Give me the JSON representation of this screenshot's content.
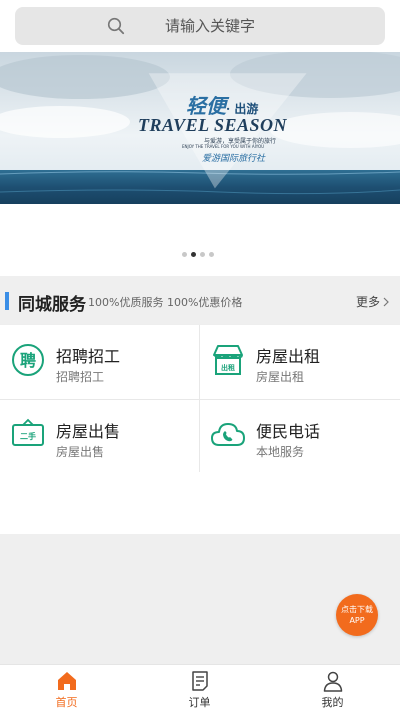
{
  "search": {
    "placeholder": "请输入关键字"
  },
  "banner": {
    "headline_cn": "轻便",
    "headline_suffix": "· 出游",
    "title": "TRAVEL SEASON",
    "subtitle_cn": "与爱游，享受属于你的旅行",
    "subtitle_en": "ENJOY THE TRAVEL FOR YOU WITH AIYOU",
    "brand": "爱游国际旅行社",
    "slide_count": 4,
    "active_slide": 2
  },
  "section": {
    "title": "同城服务",
    "desc": "100%优质服务 100%优惠价格",
    "more": "更多"
  },
  "services": [
    {
      "title": "招聘招工",
      "subtitle": "招聘招工",
      "icon": "recruit-icon",
      "icon_text": "聘"
    },
    {
      "title": "房屋出租",
      "subtitle": "房屋出租",
      "icon": "house-rent-icon",
      "icon_text": "出租"
    },
    {
      "title": "房屋出售",
      "subtitle": "房屋出售",
      "icon": "second-hand-icon",
      "icon_text": "二手"
    },
    {
      "title": "便民电话",
      "subtitle": "本地服务",
      "icon": "phone-cloud-icon"
    }
  ],
  "download": {
    "label": "点击下载APP"
  },
  "tabs": [
    {
      "label": "首页",
      "icon": "home-icon",
      "active": true
    },
    {
      "label": "订单",
      "icon": "order-icon",
      "active": false
    },
    {
      "label": "我的",
      "icon": "user-icon",
      "active": false
    }
  ],
  "colors": {
    "accent": "#f26b1d",
    "section_accent": "#3a8ee6",
    "icon_green": "#1aa37a"
  }
}
